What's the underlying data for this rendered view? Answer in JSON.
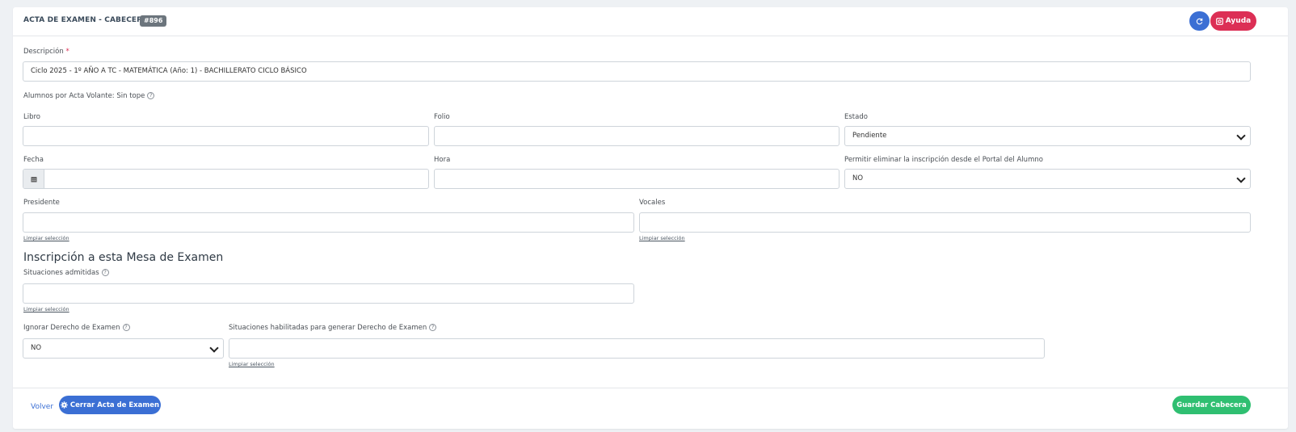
{
  "header": {
    "title": "ACTA DE EXAMEN - CABECERA",
    "badge": "#896",
    "help_label": "Ayuda",
    "refresh_icon": "refresh-icon",
    "help_icon": "life-ring-icon"
  },
  "form": {
    "descripcion": {
      "label": "Descripción",
      "required_mark": "*",
      "value": "Ciclo 2025 - 1º AÑO A TC - MATEMÁTICA (Año: 1) - BACHILLERATO CICLO BÁSICO"
    },
    "alumnos_info": "Alumnos por Acta Volante: Sin tope",
    "libro": {
      "label": "Libro",
      "value": ""
    },
    "folio": {
      "label": "Folio",
      "value": ""
    },
    "estado": {
      "label": "Estado",
      "value": "Pendiente"
    },
    "fecha": {
      "label": "Fecha",
      "value": ""
    },
    "hora": {
      "label": "Hora",
      "value": ""
    },
    "permitir_eliminar": {
      "label": "Permitir eliminar la inscripción desde el Portal del Alumno",
      "value": "NO"
    },
    "presidente": {
      "label": "Presidente",
      "value": "",
      "clear": "Limpiar selección"
    },
    "vocales": {
      "label": "Vocales",
      "value": "",
      "clear": "Limpiar selección"
    }
  },
  "inscripcion": {
    "title": "Inscripción a esta Mesa de Examen",
    "situaciones_admitidas": {
      "label": "Situaciones admitidas",
      "value": "",
      "clear": "Limpiar selección"
    },
    "ignorar_derecho": {
      "label": "Ignorar Derecho de Examen",
      "value": "NO"
    },
    "situaciones_habilitadas": {
      "label": "Situaciones habilitadas para generar Derecho de Examen",
      "value": "",
      "clear": "Limpiar selección"
    }
  },
  "footer": {
    "back_label": "Volver",
    "close_label": "Cerrar Acta de Examen",
    "save_label": "Guardar Cabecera"
  },
  "colors": {
    "primary": "#3b6fd4",
    "danger": "#dc2f55",
    "success": "#2fbf71",
    "badge": "#6c757d"
  }
}
